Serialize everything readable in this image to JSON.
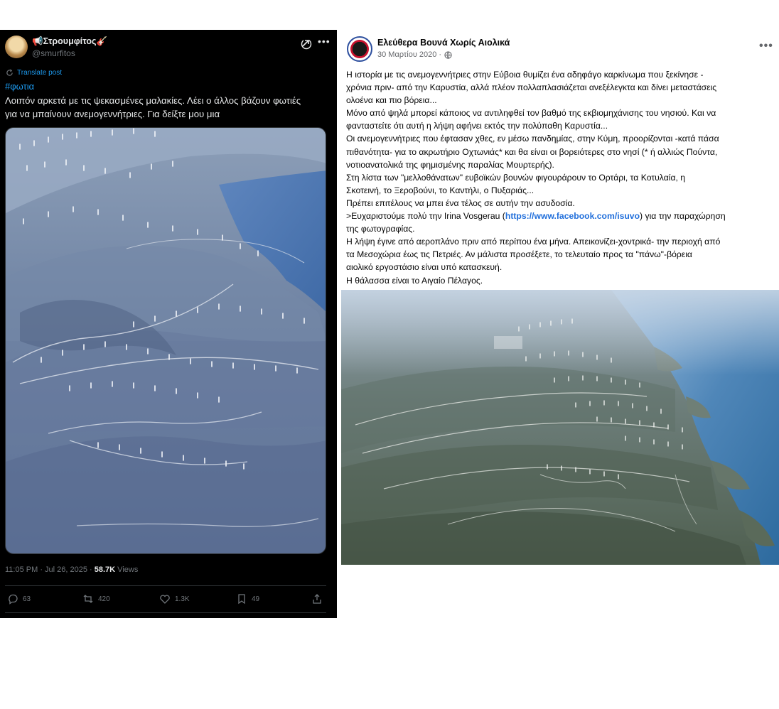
{
  "x_post": {
    "display_name": "📢Στρουμφίτος🎸",
    "handle": "@smurfitos",
    "more_icon": "more-horizontal-icon",
    "translate_label": "Translate post",
    "hashtag": "#φωτια",
    "text_line1": "Λοιπόν αρκετά με τις ψεκασμένες μαλακίες. Λέει ο άλλος βάζουν φωτιές",
    "text_line2": "για να μπαίνουν ανεμογεννήτριες. Για δείξτε μου μια",
    "photo_alt": "aerial-photo-wind-turbines",
    "timestamp": "11:05 PM · Jul 26, 2025 · ",
    "views_count": "58.7K",
    "views_label": " Views",
    "actions": {
      "replies": "63",
      "reposts": "420",
      "likes": "1.3K",
      "bookmarks": "49"
    }
  },
  "fb_post": {
    "page_name": "Ελεύθερα Βουνά Χωρίς Αιολικά",
    "date": "30 Μαρτίου 2020 ·",
    "more_icon": "more-horizontal-icon",
    "lines": [
      "Η ιστορία με τις  ανεμογεννήτριες στην Εύβοια θυμίζει ένα αδηφάγο καρκίνωμα που ξεκίνησε -",
      "χρόνια πριν- από την Καρυστία, αλλά πλέον πολλαπλασιάζεται ανεξέλεγκτα και δίνει μεταστάσεις",
      "ολοένα και πιο βόρεια...",
      "Μόνο από ψηλά μπορεί κάποιος να αντιληφθεί τον βαθμό της εκβιομηχάνισης του νησιού. Και να",
      "φανταστείτε ότι αυτή η λήψη αφήνει εκτός την πολύπαθη Καρυστία...",
      "Οι ανεμογεννήτριες που έφτασαν χθες, εν μέσω πανδημίας, στην Κύμη, προορίζονται -κατά πάσα",
      "πιθανότητα- για το ακρωτήριο Οχτωνιάς* και θα είναι οι βορειότερες στο νησί (* ή αλλιώς Πούντα,",
      "νοτιοανατολικά της φημισμένης παραλίας Μουρτερής).",
      "Στη λίστα των \"μελλοθάνατων\" ευβοϊκών βουνών φιγουράρουν το Ορτάρι, τα Κοτυλαία, η",
      "Σκοτεινή, το Ξεροβούνι, το Καντήλι, ο Πυξαριάς..."
    ],
    "line_end_1": "Πρέπει επιτέλους να μπει ένα τέλος  σε αυτήν την ασυδοσία.",
    "thanks_prefix": ">Ευχαριστούμε πολύ την Irina Vosgerau (",
    "thanks_link": "https://www.facebook.com/isuvo",
    "thanks_suffix": ") για την παραχώρηση",
    "thanks_line2": "της φωτογραφίας.",
    "lines_tail": [
      "Η λήψη έγινε από αεροπλάνο πριν από περίπου ένα μήνα. Απεικονίζει-χοντρικά- την περιοχή από",
      "τα Μεσοχώρια έως τις Πετριές. Αν μάλιστα προσέξετε, το τελευταίο προς τα \"πάνω\"-βόρεια",
      "αιολικό εργοστάσιο είναι υπό κατασκευή.",
      "Η θάλασσα είναι το Αιγαίο Πέλαγος."
    ],
    "photo_alt": "aerial-photo-coastline-wind-farms"
  }
}
